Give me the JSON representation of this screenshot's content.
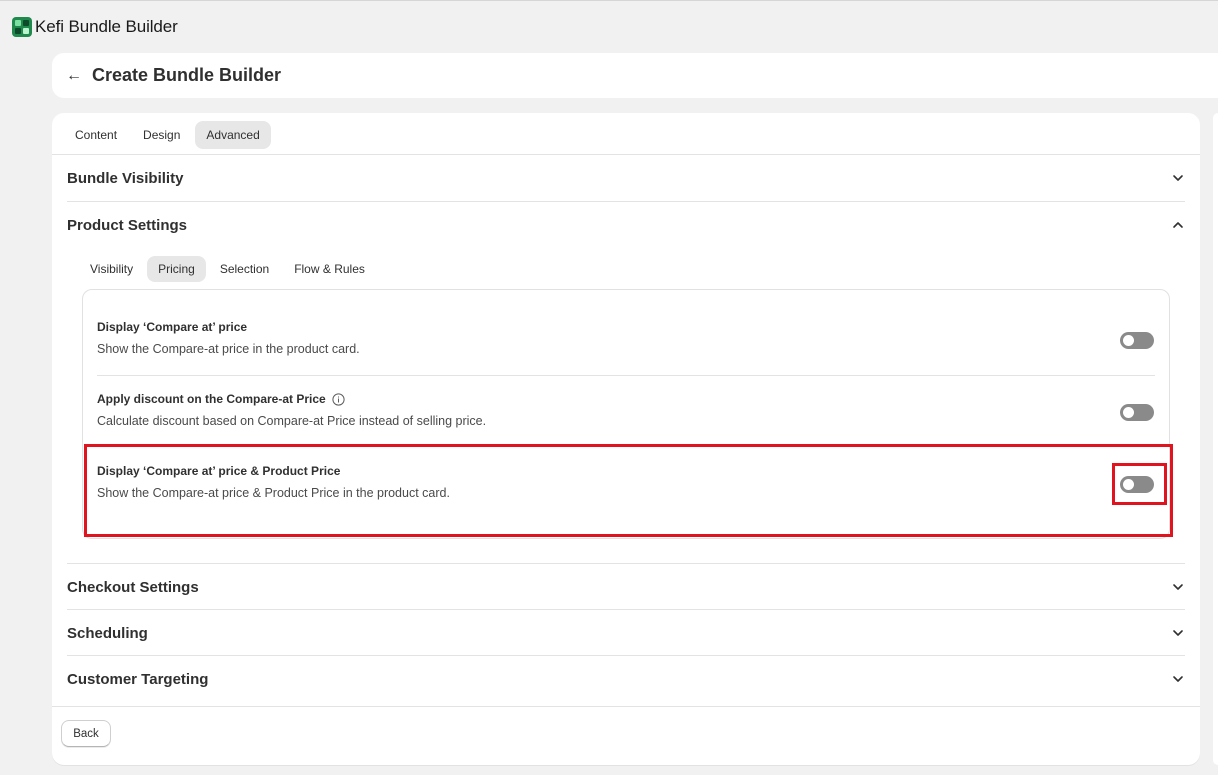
{
  "app": {
    "name": "Kefi Bundle Builder",
    "logo_icon": "kefi-logo-icon"
  },
  "header": {
    "title": "Create Bundle Builder",
    "back_icon": "arrow-left-icon"
  },
  "tabs": [
    {
      "label": "Content",
      "active": false
    },
    {
      "label": "Design",
      "active": false
    },
    {
      "label": "Advanced",
      "active": true
    }
  ],
  "sections": {
    "bundle_visibility": {
      "title": "Bundle Visibility",
      "expanded": false
    },
    "product_settings": {
      "title": "Product Settings",
      "expanded": true
    },
    "checkout_settings": {
      "title": "Checkout Settings",
      "expanded": false
    },
    "scheduling": {
      "title": "Scheduling",
      "expanded": false
    },
    "customer_targeting": {
      "title": "Customer Targeting",
      "expanded": false
    }
  },
  "product_subtabs": [
    {
      "label": "Visibility",
      "active": false
    },
    {
      "label": "Pricing",
      "active": true
    },
    {
      "label": "Selection",
      "active": false
    },
    {
      "label": "Flow & Rules",
      "active": false
    }
  ],
  "pricing_settings": [
    {
      "title": "Display ‘Compare at’ price",
      "description": "Show the Compare-at price in the product card.",
      "enabled": false
    },
    {
      "title": "Apply discount on the Compare-at Price",
      "description": "Calculate discount based on Compare-at Price instead of selling price.",
      "enabled": false,
      "has_info_icon": true
    },
    {
      "title": "Display ‘Compare at’ price & Product Price",
      "description": "Show the Compare-at price & Product Price in the product card.",
      "enabled": false
    }
  ],
  "footer": {
    "back_label": "Back"
  },
  "colors": {
    "highlight": "#e0141e",
    "toggle_off": "#8a8a8a",
    "active_tab_bg": "#e7e7e7"
  }
}
